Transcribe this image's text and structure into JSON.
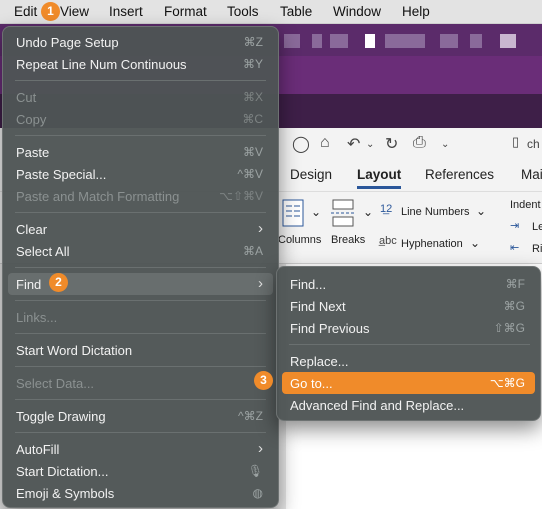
{
  "menubar": {
    "items": [
      "Edit",
      "View",
      "Insert",
      "Format",
      "Tools",
      "Table",
      "Window",
      "Help"
    ]
  },
  "badges": {
    "b1": "1",
    "b2": "2",
    "b3": "3"
  },
  "accent": "#f08b2a",
  "edit_menu": {
    "undo": {
      "label": "Undo Page Setup",
      "shortcut": "⌘Z"
    },
    "repeat": {
      "label": "Repeat Line Num Continuous",
      "shortcut": "⌘Y"
    },
    "cut": {
      "label": "Cut",
      "shortcut": "⌘X"
    },
    "copy": {
      "label": "Copy",
      "shortcut": "⌘C"
    },
    "paste": {
      "label": "Paste",
      "shortcut": "⌘V"
    },
    "paste_special": {
      "label": "Paste Special...",
      "shortcut": "^⌘V"
    },
    "paste_match": {
      "label": "Paste and Match Formatting",
      "shortcut": "⌥⇧⌘V"
    },
    "clear": {
      "label": "Clear"
    },
    "select_all": {
      "label": "Select All",
      "shortcut": "⌘A"
    },
    "find": {
      "label": "Find"
    },
    "links": {
      "label": "Links..."
    },
    "start_word_dictation": {
      "label": "Start Word Dictation"
    },
    "select_data": {
      "label": "Select Data..."
    },
    "toggle_drawing": {
      "label": "Toggle Drawing",
      "shortcut": "^⌘Z"
    },
    "autofill": {
      "label": "AutoFill"
    },
    "start_dictation": {
      "label": "Start Dictation..."
    },
    "emoji": {
      "label": "Emoji & Symbols"
    }
  },
  "find_menu": {
    "find": {
      "label": "Find...",
      "shortcut": "⌘F"
    },
    "find_next": {
      "label": "Find Next",
      "shortcut": "⌘G"
    },
    "find_previous": {
      "label": "Find Previous",
      "shortcut": "⇧⌘G"
    },
    "replace": {
      "label": "Replace..."
    },
    "goto": {
      "label": "Go to...",
      "shortcut": "⌥⌘G"
    },
    "advanced": {
      "label": "Advanced Find and Replace..."
    }
  },
  "word": {
    "tabs": [
      "Design",
      "Layout",
      "References",
      "Mai"
    ],
    "active_tab": "Layout",
    "doc_tab_label": "ch",
    "ribbon": {
      "columns": "Columns",
      "breaks": "Breaks",
      "line_numbers": "Line Numbers",
      "hyphenation": "Hyphenation",
      "indent": "Indent",
      "le": "Le",
      "ri": "Ri"
    }
  }
}
